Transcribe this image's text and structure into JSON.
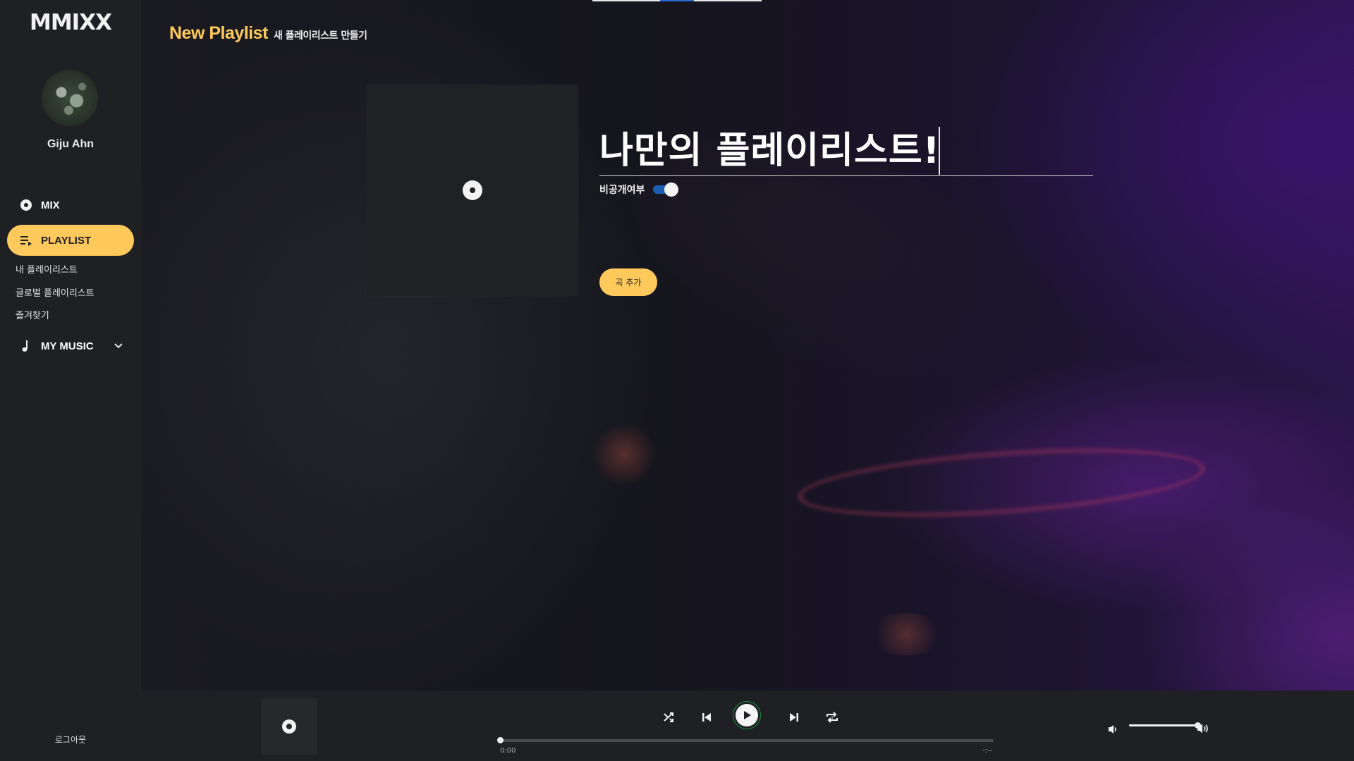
{
  "app": {
    "logo": "MMIXX"
  },
  "user": {
    "name": "Giju Ahn"
  },
  "sidebar": {
    "mix_label": "MIX",
    "playlist_label": "PLAYLIST",
    "sub_items": [
      "내 플레이리스트",
      "글로벌 플레이리스트",
      "즐겨찾기"
    ],
    "mymusic_label": "MY MUSIC",
    "logout_label": "로그아웃"
  },
  "header": {
    "title": "New Playlist",
    "subtitle": "새 플레이리스트 만들기"
  },
  "playlist": {
    "title_value": "나만의 플레이리스트!",
    "private_label": "비공개여부",
    "private_enabled": true,
    "add_song_label": "곡 추가"
  },
  "player": {
    "current_time": "0:00",
    "total_time": "-:--",
    "progress": 0,
    "volume": 1.0
  },
  "colors": {
    "accent": "#ffc95c",
    "toggle": "#1a5fb4",
    "sidebar_bg": "#1e2023"
  },
  "icons": {
    "mix": "disc-icon",
    "playlist": "playlist-icon",
    "mymusic": "music-note-icon",
    "shuffle": "shuffle-icon",
    "prev": "skip-previous-icon",
    "play": "play-icon",
    "next": "skip-next-icon",
    "repeat": "repeat-icon",
    "volume_low": "volume-low-icon",
    "volume_high": "volume-high-icon"
  }
}
